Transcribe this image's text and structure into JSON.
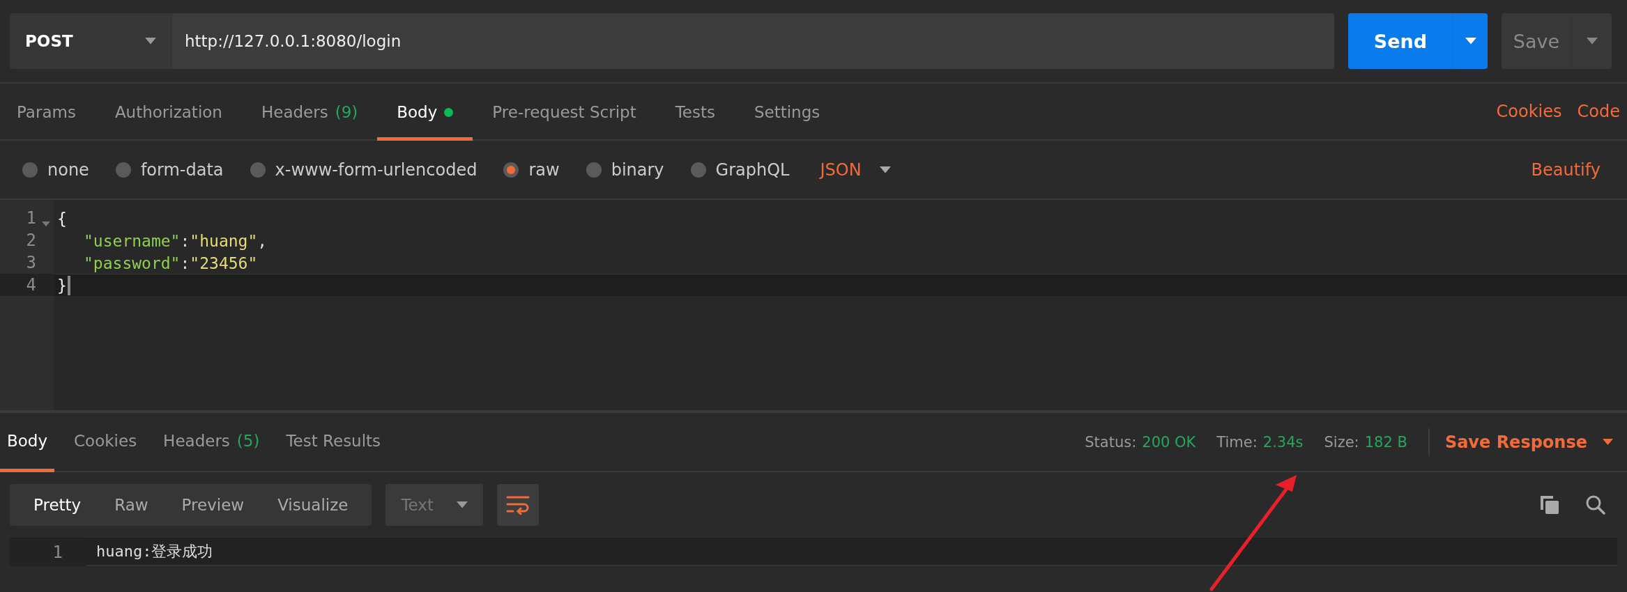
{
  "request": {
    "method": "POST",
    "url": "http://127.0.0.1:8080/login",
    "send": "Send",
    "save": "Save"
  },
  "request_tabs": [
    {
      "label": "Params",
      "selected": false,
      "dot": false
    },
    {
      "label": "Authorization",
      "selected": false,
      "dot": false
    },
    {
      "label": "Headers",
      "badge": "(9)",
      "selected": false,
      "dot": false
    },
    {
      "label": "Body",
      "selected": true,
      "dot": true
    },
    {
      "label": "Pre-request Script",
      "selected": false,
      "dot": false
    },
    {
      "label": "Tests",
      "selected": false,
      "dot": false
    },
    {
      "label": "Settings",
      "selected": false,
      "dot": false
    }
  ],
  "request_links": [
    "Cookies",
    "Code"
  ],
  "body_types": [
    {
      "label": "none",
      "selected": false
    },
    {
      "label": "form-data",
      "selected": false
    },
    {
      "label": "x-www-form-urlencoded",
      "selected": false
    },
    {
      "label": "raw",
      "selected": true
    },
    {
      "label": "binary",
      "selected": false
    },
    {
      "label": "GraphQL",
      "selected": false
    }
  ],
  "body_format": "JSON",
  "beautify": "Beautify",
  "editor": [
    {
      "number": "1",
      "kind": "outer",
      "foldable": true,
      "current": false,
      "tokens": [
        {
          "kind": "brace",
          "text": "{"
        }
      ]
    },
    {
      "number": "2",
      "kind": "member",
      "foldable": false,
      "current": false,
      "tokens": [
        {
          "kind": "key",
          "text": "\"username\""
        },
        {
          "kind": "punct",
          "text": ":"
        },
        {
          "kind": "string",
          "text": "\"huang\""
        },
        {
          "kind": "punct",
          "text": ","
        }
      ]
    },
    {
      "number": "3",
      "kind": "member",
      "foldable": false,
      "current": false,
      "tokens": [
        {
          "kind": "key",
          "text": "\"password\""
        },
        {
          "kind": "punct",
          "text": ":"
        },
        {
          "kind": "string",
          "text": "\"23456\""
        }
      ]
    },
    {
      "number": "4",
      "kind": "outer",
      "foldable": false,
      "current": true,
      "tokens": [
        {
          "kind": "brace",
          "text": "}"
        }
      ]
    }
  ],
  "response_tabs": [
    {
      "label": "Body",
      "selected": true
    },
    {
      "label": "Cookies",
      "selected": false
    },
    {
      "label": "Headers",
      "badge": "(5)",
      "selected": false
    },
    {
      "label": "Test Results",
      "selected": false
    }
  ],
  "response_meta": [
    {
      "label": "Status:",
      "value": "200 OK"
    },
    {
      "label": "Time:",
      "value": "2.34s"
    },
    {
      "label": "Size:",
      "value": "182 B"
    }
  ],
  "save_response": "Save Response",
  "view_modes": [
    {
      "label": "Pretty",
      "selected": true
    },
    {
      "label": "Raw",
      "selected": false
    },
    {
      "label": "Preview",
      "selected": false
    },
    {
      "label": "Visualize",
      "selected": false
    }
  ],
  "response_format": "Text",
  "wrap_on": true,
  "response_lines": [
    {
      "number": "1",
      "text": "huang:登录成功"
    }
  ]
}
